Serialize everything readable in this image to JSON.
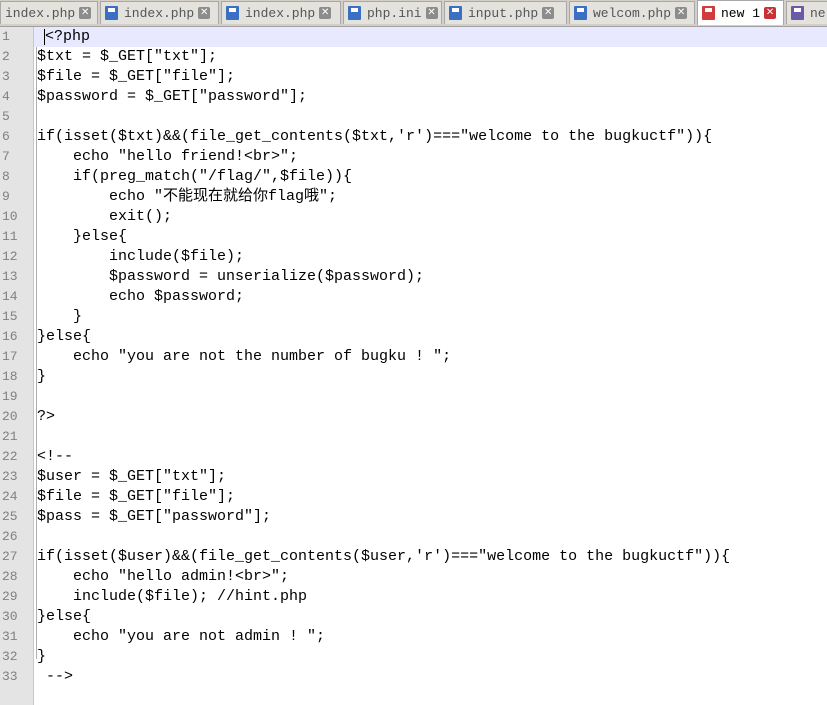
{
  "tabs": [
    {
      "label": "index.php",
      "icon": "blue",
      "active": false
    },
    {
      "label": "index.php",
      "icon": "blue",
      "active": false
    },
    {
      "label": "index.php",
      "icon": "blue",
      "active": false
    },
    {
      "label": "php.ini",
      "icon": "blue",
      "active": false
    },
    {
      "label": "input.php",
      "icon": "blue",
      "active": false
    },
    {
      "label": "welcom.php",
      "icon": "blue",
      "active": false
    },
    {
      "label": "new 1",
      "icon": "red",
      "active": true
    },
    {
      "label": "ne",
      "icon": "purple",
      "active": false
    }
  ],
  "editor": {
    "lines": [
      {
        "n": "1",
        "text": "<?php"
      },
      {
        "n": "2",
        "text": "$txt = $_GET[\"txt\"];"
      },
      {
        "n": "3",
        "text": "$file = $_GET[\"file\"];"
      },
      {
        "n": "4",
        "text": "$password = $_GET[\"password\"];"
      },
      {
        "n": "5",
        "text": ""
      },
      {
        "n": "6",
        "text": "if(isset($txt)&&(file_get_contents($txt,'r')===\"welcome to the bugkuctf\")){"
      },
      {
        "n": "7",
        "text": "    echo \"hello friend!<br>\";"
      },
      {
        "n": "8",
        "text": "    if(preg_match(\"/flag/\",$file)){"
      },
      {
        "n": "9",
        "text": "        echo \"不能现在就给你flag哦\";"
      },
      {
        "n": "10",
        "text": "        exit();"
      },
      {
        "n": "11",
        "text": "    }else{"
      },
      {
        "n": "12",
        "text": "        include($file);"
      },
      {
        "n": "13",
        "text": "        $password = unserialize($password);"
      },
      {
        "n": "14",
        "text": "        echo $password;"
      },
      {
        "n": "15",
        "text": "    }"
      },
      {
        "n": "16",
        "text": "}else{"
      },
      {
        "n": "17",
        "text": "    echo \"you are not the number of bugku ! \";"
      },
      {
        "n": "18",
        "text": "}"
      },
      {
        "n": "19",
        "text": ""
      },
      {
        "n": "20",
        "text": "?>"
      },
      {
        "n": "21",
        "text": ""
      },
      {
        "n": "22",
        "text": "<!--"
      },
      {
        "n": "23",
        "text": "$user = $_GET[\"txt\"];"
      },
      {
        "n": "24",
        "text": "$file = $_GET[\"file\"];"
      },
      {
        "n": "25",
        "text": "$pass = $_GET[\"password\"];"
      },
      {
        "n": "26",
        "text": ""
      },
      {
        "n": "27",
        "text": "if(isset($user)&&(file_get_contents($user,'r')===\"welcome to the bugkuctf\")){"
      },
      {
        "n": "28",
        "text": "    echo \"hello admin!<br>\";"
      },
      {
        "n": "29",
        "text": "    include($file); //hint.php"
      },
      {
        "n": "30",
        "text": "}else{"
      },
      {
        "n": "31",
        "text": "    echo \"you are not admin ! \";"
      },
      {
        "n": "32",
        "text": "}"
      },
      {
        "n": "33",
        "text": " -->"
      }
    ]
  }
}
